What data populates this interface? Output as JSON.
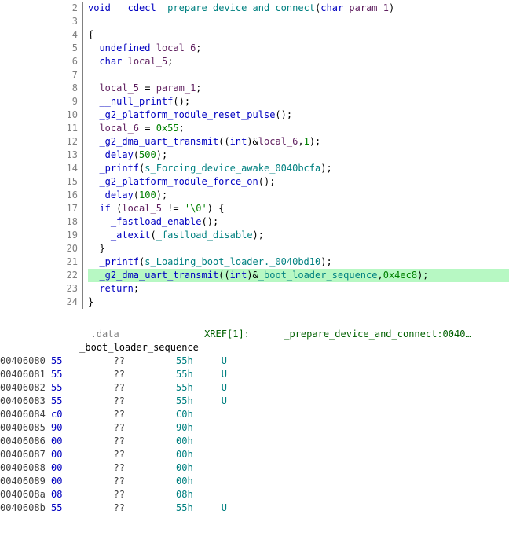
{
  "decompiler": {
    "lines": [
      {
        "n": 2,
        "html": "<span class='c-keyword'>void</span> <span class='c-keyword'>__cdecl</span> <span class='c-global'>_prepare_device_and_connect</span>(<span class='c-keyword'>char</span> <span class='c-param'>param_1</span>)"
      },
      {
        "n": 3,
        "html": ""
      },
      {
        "n": 4,
        "html": "{"
      },
      {
        "n": 5,
        "html": "  <span class='c-undef'>undefined</span> <span class='c-local'>local_6</span>;"
      },
      {
        "n": 6,
        "html": "  <span class='c-keyword'>char</span> <span class='c-local'>local_5</span>;"
      },
      {
        "n": 7,
        "html": ""
      },
      {
        "n": 8,
        "html": "  <span class='c-local'>local_5</span> = <span class='c-param'>param_1</span>;"
      },
      {
        "n": 9,
        "html": "  <span class='c-func'>__null_printf</span>();"
      },
      {
        "n": 10,
        "html": "  <span class='c-func'>_g2_platform_module_reset_pulse</span>();"
      },
      {
        "n": 11,
        "html": "  <span class='c-local'>local_6</span> = <span class='c-num'>0x55</span>;"
      },
      {
        "n": 12,
        "html": "  <span class='c-func'>_g2_dma_uart_transmit</span>((<span class='c-int'>int</span>)&amp;<span class='c-local'>local_6</span>,<span class='c-num'>1</span>);"
      },
      {
        "n": 13,
        "html": "  <span class='c-func'>_delay</span>(<span class='c-num'>500</span>);"
      },
      {
        "n": 14,
        "html": "  <span class='c-func'>_printf</span>(<span class='c-global'>s_Forcing_device_awake_0040bcfa</span>);"
      },
      {
        "n": 15,
        "html": "  <span class='c-func'>_g2_platform_module_force_on</span>();"
      },
      {
        "n": 16,
        "html": "  <span class='c-func'>_delay</span>(<span class='c-num'>100</span>);"
      },
      {
        "n": 17,
        "html": "  <span class='c-keyword'>if</span> (<span class='c-local'>local_5</span> != <span class='c-char'>'\\0'</span>) {"
      },
      {
        "n": 18,
        "html": "    <span class='c-func'>_fastload_enable</span>();"
      },
      {
        "n": 19,
        "html": "    <span class='c-func'>_atexit</span>(<span class='c-global'>_fastload_disable</span>);"
      },
      {
        "n": 20,
        "html": "  }"
      },
      {
        "n": 21,
        "html": "  <span class='c-func'>_printf</span>(<span class='c-global'>s_Loading_boot_loader._0040bd10</span>);"
      },
      {
        "n": 22,
        "html": "  <span class='c-func'>_g2_dma_uart_transmit</span>((<span class='c-int'>int</span>)&amp;<span class='c-global'>_boot_loader_sequence</span>,<span class='c-num'>0x4ec8</span>);",
        "highlight": true
      },
      {
        "n": 23,
        "html": "  <span class='c-keyword'>return</span>;"
      },
      {
        "n": 24,
        "html": "}"
      }
    ]
  },
  "listing": {
    "section": ".data",
    "xref_label": "XREF[1]:",
    "xref_target": "_prepare_device_and_connect:0040…",
    "symbol": "_boot_loader_sequence",
    "rows": [
      {
        "addr": "00406080",
        "byte": "55",
        "op": "??",
        "hex": "55h",
        "asc": "U"
      },
      {
        "addr": "00406081",
        "byte": "55",
        "op": "??",
        "hex": "55h",
        "asc": "U"
      },
      {
        "addr": "00406082",
        "byte": "55",
        "op": "??",
        "hex": "55h",
        "asc": "U"
      },
      {
        "addr": "00406083",
        "byte": "55",
        "op": "??",
        "hex": "55h",
        "asc": "U"
      },
      {
        "addr": "00406084",
        "byte": "c0",
        "op": "??",
        "hex": "C0h",
        "asc": ""
      },
      {
        "addr": "00406085",
        "byte": "90",
        "op": "??",
        "hex": "90h",
        "asc": ""
      },
      {
        "addr": "00406086",
        "byte": "00",
        "op": "??",
        "hex": "00h",
        "asc": ""
      },
      {
        "addr": "00406087",
        "byte": "00",
        "op": "??",
        "hex": "00h",
        "asc": ""
      },
      {
        "addr": "00406088",
        "byte": "00",
        "op": "??",
        "hex": "00h",
        "asc": ""
      },
      {
        "addr": "00406089",
        "byte": "00",
        "op": "??",
        "hex": "00h",
        "asc": ""
      },
      {
        "addr": "0040608a",
        "byte": "08",
        "op": "??",
        "hex": "08h",
        "asc": ""
      },
      {
        "addr": "0040608b",
        "byte": "55",
        "op": "??",
        "hex": "55h",
        "asc": "U"
      }
    ]
  }
}
